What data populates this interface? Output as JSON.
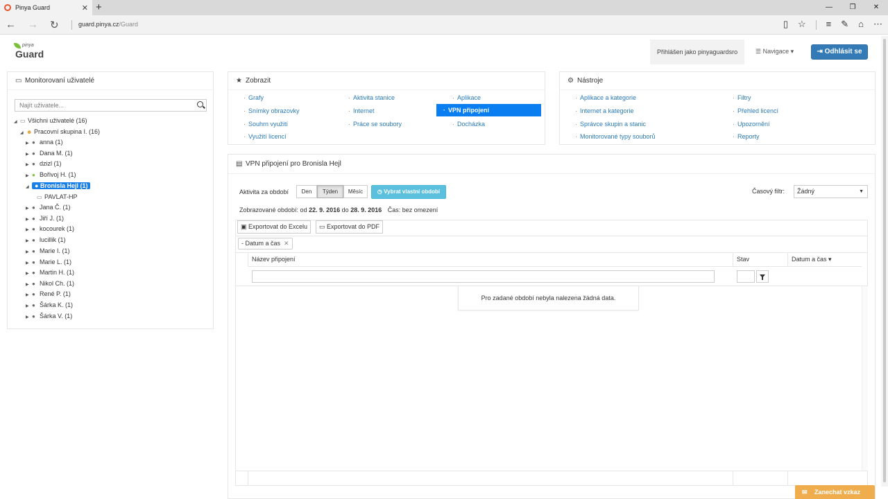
{
  "browser": {
    "tab_title": "Pinya Guard",
    "url_domain": "guard.pinya.cz",
    "url_path": "/Guard"
  },
  "header": {
    "logo_small": "pinya",
    "logo_big": "Guard",
    "logged_in": "Přihlášen jako pinyaguardsro",
    "navigation": "Navigace ▾",
    "logout": "Odhlásit se"
  },
  "users_panel": {
    "title": "Monitorovaní uživatelé",
    "search_placeholder": "Najít uživatele...",
    "root": "Všichni uživatelé (16)",
    "group": "Pracovní skupina I. (16)",
    "users": [
      "anna (1)",
      "Dana M. (1)",
      "dzizl (1)",
      "Bořivoj H. (1)",
      "Bronisla Hejl (1)",
      "Jana Č. (1)",
      "Jiří J. (1)",
      "kocourek (1)",
      "lucillik (1)",
      "Marie I. (1)",
      "Marie L. (1)",
      "Martin H. (1)",
      "Nikol Ch. (1)",
      "René P. (1)",
      "Šárka K. (1)",
      "Šárka V. (1)"
    ],
    "device": "PAVLAT-HP"
  },
  "show_panel": {
    "title": "Zobrazit",
    "links": [
      "Grafy",
      "Aktivita stanice",
      "Aplikace",
      "Snímky obrazovky",
      "Internet",
      "VPN připojení",
      "Souhrn využití",
      "Práce se soubory",
      "Docházka",
      "Využití licencí"
    ]
  },
  "tools_panel": {
    "title": "Nástroje",
    "links": [
      "Aplikace a kategorie",
      "Filtry",
      "Internet a kategorie",
      "Přehled licencí",
      "Správce skupin a stanic",
      "Upozornění",
      "Monitorované typy souborů",
      "Reporty"
    ]
  },
  "main": {
    "title": "VPN připojení pro Bronisla Hejl",
    "period_label": "Aktivita za období",
    "period_buttons": [
      "Den",
      "Týden",
      "Měsíc"
    ],
    "custom_period": "Vybrat vlastní období",
    "time_filter_label": "Časový filtr:",
    "time_filter_value": "Žádný",
    "shown_prefix": "Zobrazované období: od",
    "date_from": "22. 9. 2016",
    "date_to_word": "do",
    "date_to": "28. 9. 2016",
    "time_info": "Čas: bez omezení",
    "export_excel": "Exportovat do Excelu",
    "export_pdf": "Exportovat do PDF",
    "sort_chip": "Datum a čas",
    "columns": [
      "Název připojení",
      "Stav",
      "Datum a čas ▾"
    ],
    "no_data": "Pro zadané období nebyla nalezena žádná data."
  },
  "feedback": "Zanechat vzkaz"
}
